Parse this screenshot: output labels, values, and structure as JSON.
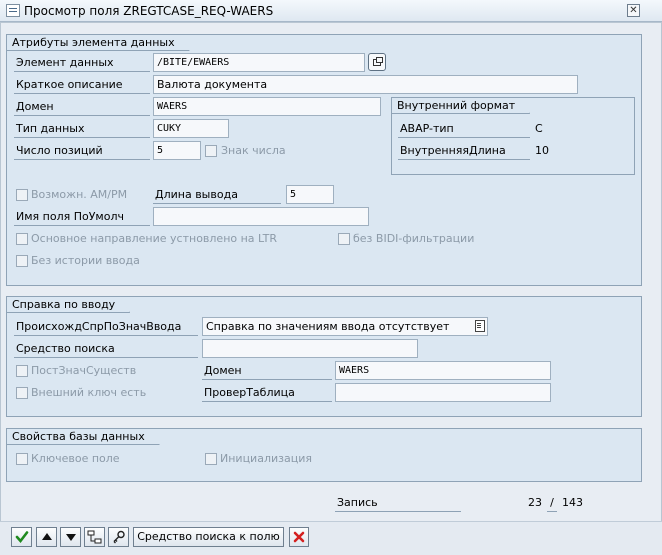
{
  "window": {
    "title": "Просмотр поля ZREGTCASE_REQ-WAERS",
    "close_glyph": "✕"
  },
  "attributes": {
    "group_title": "Атрибуты элемента данных",
    "data_element_label": "Элемент данных",
    "data_element_value": "/BITE/EWAERS",
    "short_desc_label": "Краткое описание",
    "short_desc_value": "Валюта документа",
    "domain_label": "Домен",
    "domain_value": "WAERS",
    "datatype_label": "Тип данных",
    "datatype_value": "CUKY",
    "positions_label": "Число позиций",
    "positions_value": "5",
    "sign_label": "Знак числа",
    "ampm_label": "Возможн. AM/PM",
    "output_len_label": "Длина вывода",
    "output_len_value": "5",
    "param_label": "Имя поля ПоУмолч",
    "param_value": "",
    "ltr_label": "Основное направление устновлено на LTR",
    "bidi_label": "без BIDI-фильтрации",
    "history_label": "Без истории ввода"
  },
  "internal": {
    "group_title": "Внутренний формат",
    "abap_label": "ABAP-тип",
    "abap_value": "C",
    "len_label": "ВнутренняяДлина",
    "len_value": "10"
  },
  "input_help": {
    "group_title": "Справка по вводу",
    "origin_label": "ПроисхождСпрПоЗначВвода",
    "origin_value": "Справка по значениям ввода отсутствует",
    "search_label": "Средство поиска",
    "search_value": "",
    "fixed_label": "ПостЗначСуществ",
    "domain_label": "Домен",
    "domain_value": "WAERS",
    "fk_label": "Внешний ключ есть",
    "checktable_label": "ПроверТаблица",
    "checktable_value": ""
  },
  "db": {
    "group_title": "Свойства базы данных",
    "key_label": "Ключевое поле",
    "init_label": "Инициализация"
  },
  "record": {
    "label": "Запись",
    "current": "23",
    "sep": "/",
    "total": "143"
  },
  "toolbar": {
    "search_help_button": "Средство поиска к полю"
  },
  "colors": {
    "check": "#1f8a1f",
    "cancel": "#d42020"
  }
}
